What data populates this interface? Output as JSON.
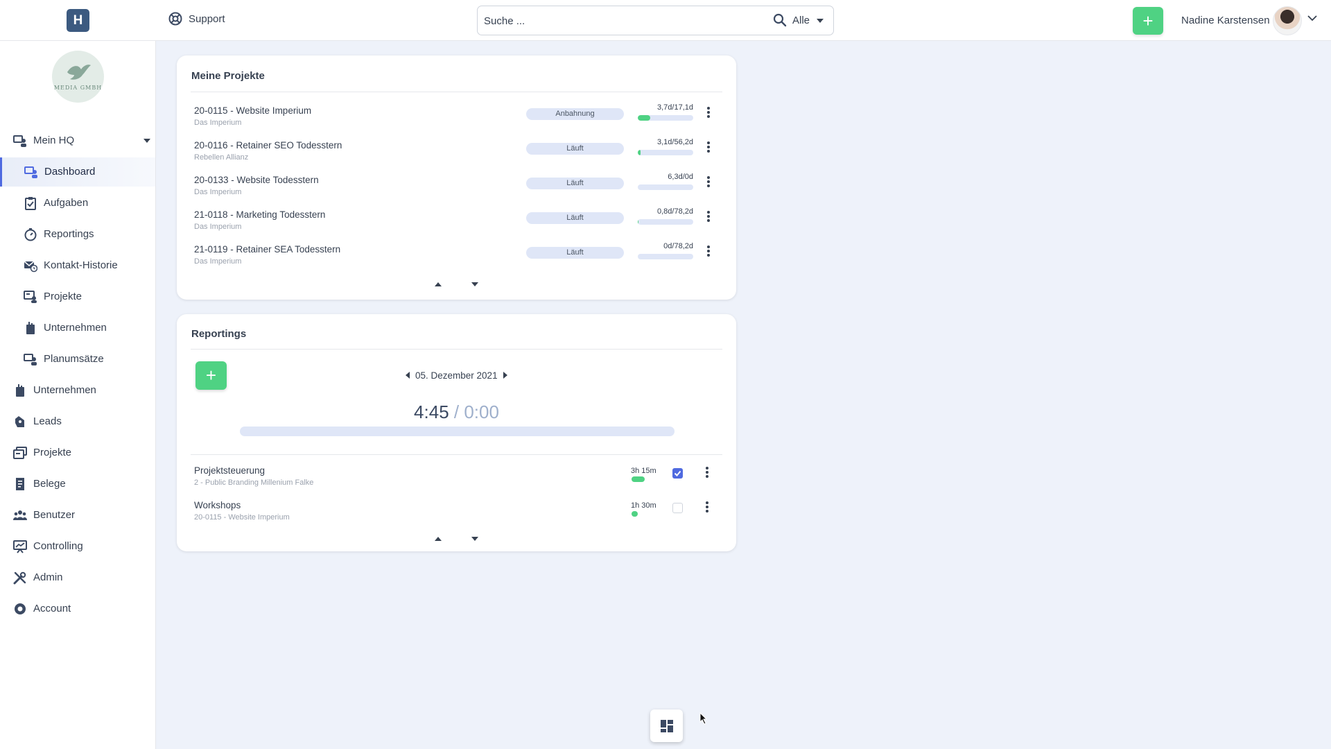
{
  "header": {
    "logo_letter": "H",
    "support_label": "Support",
    "search": {
      "placeholder": "Suche ...",
      "filter_label": "Alle"
    },
    "add_label": "+",
    "user_name": "Nadine Karstensen"
  },
  "sidebar": {
    "brand_text": "MEDIA GMBH",
    "items": [
      {
        "label": "Mein HQ",
        "icon": "mein-hq-icon",
        "level": 0
      },
      {
        "label": "Dashboard",
        "icon": "dashboard-icon",
        "level": 1,
        "active": true
      },
      {
        "label": "Aufgaben",
        "icon": "clipboard-check-icon",
        "level": 1
      },
      {
        "label": "Reportings",
        "icon": "stopwatch-icon",
        "level": 1
      },
      {
        "label": "Kontakt-Historie",
        "icon": "mail-clock-icon",
        "level": 1
      },
      {
        "label": "Projekte",
        "icon": "projects-icon",
        "level": 1
      },
      {
        "label": "Unternehmen",
        "icon": "company-icon",
        "level": 1
      },
      {
        "label": "Planumsätze",
        "icon": "planned-revenue-icon",
        "level": 1
      },
      {
        "label": "Unternehmen",
        "icon": "company-icon",
        "level": 0
      },
      {
        "label": "Leads",
        "icon": "leads-icon",
        "level": 0
      },
      {
        "label": "Projekte",
        "icon": "projects-icon",
        "level": 0
      },
      {
        "label": "Belege",
        "icon": "receipt-icon",
        "level": 0
      },
      {
        "label": "Benutzer",
        "icon": "users-icon",
        "level": 0
      },
      {
        "label": "Controlling",
        "icon": "controlling-icon",
        "level": 0
      },
      {
        "label": "Admin",
        "icon": "tools-icon",
        "level": 0
      },
      {
        "label": "Account",
        "icon": "account-icon",
        "level": 0
      }
    ]
  },
  "projects": {
    "title": "Meine Projekte",
    "rows": [
      {
        "name": "20-0115 - Website Imperium",
        "client": "Das Imperium",
        "status": "Anbahnung",
        "progress_text": "3,7d/17,1d",
        "progress": 0.22
      },
      {
        "name": "20-0116 - Retainer SEO Todesstern",
        "client": "Rebellen Allianz",
        "status": "Läuft",
        "progress_text": "3,1d/56,2d",
        "progress": 0.055
      },
      {
        "name": "20-0133 - Website Todesstern",
        "client": "Das Imperium",
        "status": "Läuft",
        "progress_text": "6,3d/0d",
        "progress": 0
      },
      {
        "name": "21-0118 - Marketing Todesstern",
        "client": "Das Imperium",
        "status": "Läuft",
        "progress_text": "0,8d/78,2d",
        "progress": 0.01
      },
      {
        "name": "21-0119 - Retainer SEA Todesstern",
        "client": "Das Imperium",
        "status": "Läuft",
        "progress_text": "0d/78,2d",
        "progress": 0
      }
    ]
  },
  "reportings": {
    "title": "Reportings",
    "add_label": "+",
    "date": "05. Dezember 2021",
    "time_done": "4:45",
    "time_sep": " / ",
    "time_target": "0:00",
    "entries": [
      {
        "name": "Projektsteuerung",
        "project": "2 - Public Branding Millenium Falke",
        "duration": "3h 15m",
        "duration_share": 0.68,
        "checked": true
      },
      {
        "name": "Workshops",
        "project": "20-0115 - Website Imperium",
        "duration": "1h 30m",
        "duration_share": 0.32,
        "checked": false
      }
    ]
  },
  "colors": {
    "accent_green": "#4fd283",
    "accent_blue": "#4f6ae0",
    "pill_bg": "#dfe6f7"
  }
}
